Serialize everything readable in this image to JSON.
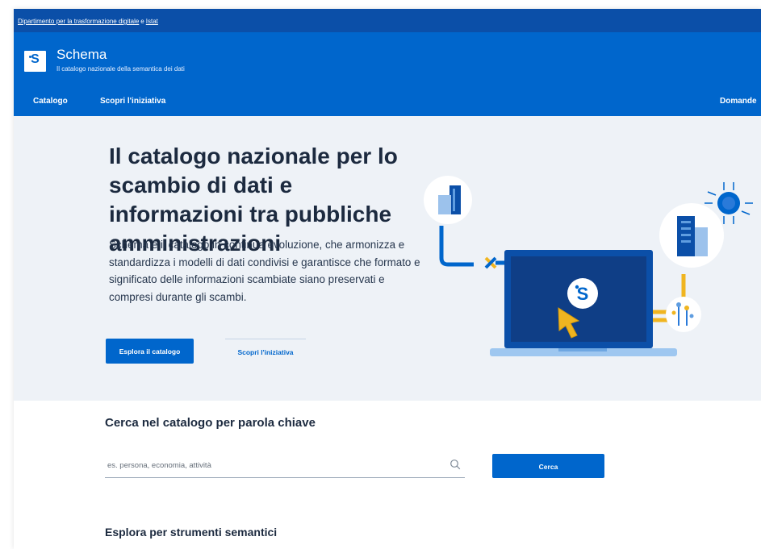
{
  "topbar": {
    "link1": "Dipartimento per la trasformazione digitale",
    "separator": "e",
    "link2": "Istat"
  },
  "header": {
    "logo_letter": "S",
    "title": "Schema",
    "subtitle": "Il catalogo nazionale della semantica dei dati"
  },
  "nav": {
    "items": [
      {
        "label": "Catalogo"
      },
      {
        "label": "Scopri l'iniziativa"
      },
      {
        "label": "Domande"
      }
    ]
  },
  "hero": {
    "title": "Il catalogo nazionale per lo scambio di dati e informazioni tra pubbliche amministrazioni",
    "description": "Schema è il catalogo in continua evoluzione, che armonizza e standardizza i modelli di dati condivisi e garantisce che formato e significato delle informazioni scambiate siano preservati e compresi durante gli scambi.",
    "primary_button": "Esplora il catalogo",
    "secondary_button": "Scopri l'iniziativa",
    "illustration_logo": "S"
  },
  "search": {
    "title": "Cerca nel catalogo per parola chiave",
    "placeholder": "es. persona, economia, attività",
    "value": "",
    "button": "Cerca"
  },
  "explore": {
    "title": "Esplora per strumenti semantici"
  },
  "colors": {
    "brand": "#0066cc",
    "topbar": "#0b4fa8",
    "hero_bg": "#eef2f7",
    "accent_yellow": "#f0b520"
  }
}
